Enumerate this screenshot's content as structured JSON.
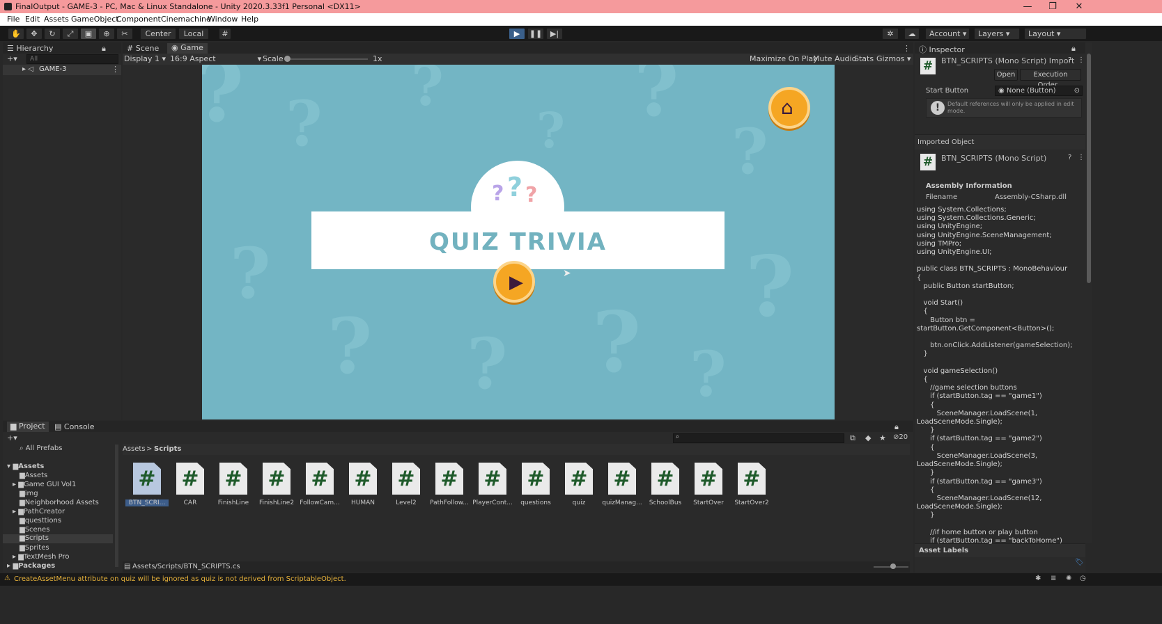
{
  "window": {
    "title": "FinalOutput - GAME-3 - PC, Mac & Linux Standalone - Unity 2020.3.33f1 Personal <DX11>",
    "minimize": "—",
    "maximize": "❐",
    "close": "✕"
  },
  "menu": [
    "File",
    "Edit",
    "Assets",
    "GameObject",
    "Component",
    "Cinemachine",
    "Window",
    "Help"
  ],
  "toolbar": {
    "pivot": "Center",
    "space": "Local",
    "account": "Account",
    "layers": "Layers",
    "layout": "Layout"
  },
  "hierarchy": {
    "tab": "Hierarchy",
    "search_placeholder": "All",
    "root": "GAME-3"
  },
  "scene_tabs": {
    "scene": "Scene",
    "game": "Game"
  },
  "game_bar": {
    "display": "Display 1",
    "aspect": "16:9 Aspect",
    "scale_label": "Scale",
    "scale_value": "1x",
    "maximize": "Maximize On Play",
    "mute": "Mute Audio",
    "stats": "Stats",
    "gizmos": "Gizmos"
  },
  "game": {
    "title": "QUIZ TRIVIA"
  },
  "inspector": {
    "tab": "Inspector",
    "script_title": "BTN_SCRIPTS (Mono Script) Import",
    "open": "Open",
    "exec_order": "Execution Order...",
    "field_label": "Start Button",
    "field_value": "None (Button)",
    "notice": "Default references will only be applied in edit mode.",
    "imported_label": "Imported Object",
    "imported_name": "BTN_SCRIPTS (Mono Script)",
    "assembly_header": "Assembly Information",
    "filename_label": "Filename",
    "filename_value": "Assembly-CSharp.dll",
    "asset_labels": "Asset Labels",
    "code": "using System.Collections;\nusing System.Collections.Generic;\nusing UnityEngine;\nusing UnityEngine.SceneManagement;\nusing TMPro;\nusing UnityEngine.UI;\n\npublic class BTN_SCRIPTS : MonoBehaviour\n{\n   public Button startButton;\n\n   void Start()\n   {\n      Button btn =\nstartButton.GetComponent<Button>();\n\n      btn.onClick.AddListener(gameSelection);\n   }\n\n   void gameSelection()\n   {\n      //game selection buttons\n      if (startButton.tag == \"game1\")\n      {\n         SceneManager.LoadScene(1,\nLoadSceneMode.Single);\n      }\n      if (startButton.tag == \"game2\")\n      {\n         SceneManager.LoadScene(3,\nLoadSceneMode.Single);\n      }\n      if (startButton.tag == \"game3\")\n      {\n         SceneManager.LoadScene(12,\nLoadSceneMode.Single);\n      }\n\n      //if home button or play button\n      if (startButton.tag == \"backToHome\")"
  },
  "project": {
    "tab_project": "Project",
    "tab_console": "Console",
    "all_prefabs": "All Prefabs",
    "crumb_assets": "Assets",
    "crumb_sep": ">",
    "crumb_scripts": "Scripts",
    "hidden_count": "20",
    "tree": [
      "Assets",
      "Assets",
      "Game GUI Vol1",
      "img",
      "Neighborhood Assets",
      "PathCreator",
      "questtions",
      "Scenes",
      "Scripts",
      "Sprites",
      "TextMesh Pro",
      "Packages"
    ],
    "files": [
      "BTN_SCRI...",
      "CAR",
      "FinishLine",
      "FinishLine2",
      "FollowCam...",
      "HUMAN",
      "Level2",
      "PathFollow...",
      "PlayerCont...",
      "questions",
      "quiz",
      "quizManag...",
      "SchoolBus",
      "StartOver",
      "StartOver2"
    ],
    "path": "Assets/Scripts/BTN_SCRIPTS.cs"
  },
  "status": {
    "message": "CreateAssetMenu attribute on quiz will be ignored as quiz is not derived from ScriptableObject."
  }
}
